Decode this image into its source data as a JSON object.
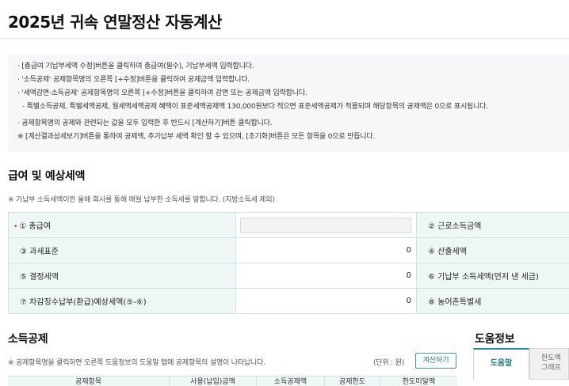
{
  "page": {
    "title": "2025년 귀속 연말정산 자동계산"
  },
  "info": {
    "lines": [
      "· [총급여 기납부세액 수정]버튼을 클릭하여 총급여(필수), 기납부세액 입력합니다.",
      "· '소득공제' 공제항목명의 오른쪽 [+수정]버튼을 클릭하여 공제금액 입력합니다.",
      "· '세액감면·소득공제' 공제항목명의 오른쪽 [+수정]버튼을 클릭하여 감면 또는 공제금액 입력합니다.",
      "- 특별소득공제, 특별세액공제, 월세액세액공제 혜택이 표준세액공제액 130,000원보다 적으면 표준세액공제가 적용되며 해당항목의 공제액은 0으로 표시됩니다.",
      "· 공제항목명의 공제와 관련되는 값을 모두 입력한 후 반드시 [계산하기]버튼 클릭합니다.",
      "※ [계산결과상세보기]버튼을 통하여 공제액, 추가납부 세액 확인 할 수 있으며, [초기화]버튼은 모든 항목을 0으로 만듭니다."
    ]
  },
  "salary": {
    "title": "급여 및 예상세액",
    "note": "※ 기납부 소득세액이란 올해 회사를 통해 매월 납부한 소득세를 말합니다. (지방소득세 제외)",
    "required_mark": "•",
    "rows": [
      {
        "left_label": "① 총급여",
        "left_value": "",
        "right_label": "② 근로소득금액"
      },
      {
        "left_label": "③ 과세표준",
        "left_value": "0",
        "right_label": "④ 산출세액"
      },
      {
        "left_label": "⑤ 결정세액",
        "left_value": "0",
        "right_label": "⑥ 기납부 소득세액(먼저 낸 세금)"
      },
      {
        "left_label": "⑦ 차감징수납부(환급)예상세액(⑤-⑥)",
        "left_value": "0",
        "right_label": "⑧ 농어촌특별세"
      }
    ]
  },
  "deduction": {
    "title": "소득공제",
    "note": "※ 공제항목명을 클릭하면 오른쪽 도움정보의 도움말 탭에 공제항목의 설명이 나타납니다.",
    "unit": "(단위 : 원)",
    "calc_button": "계산하기",
    "columns": [
      "공제항목",
      "사용(납입)금액",
      "소득공제액",
      "공제한도",
      "한도미달액"
    ]
  },
  "help": {
    "title": "도움정보",
    "tab_active": "도움말",
    "tab_other": "한도액 그래프"
  }
}
